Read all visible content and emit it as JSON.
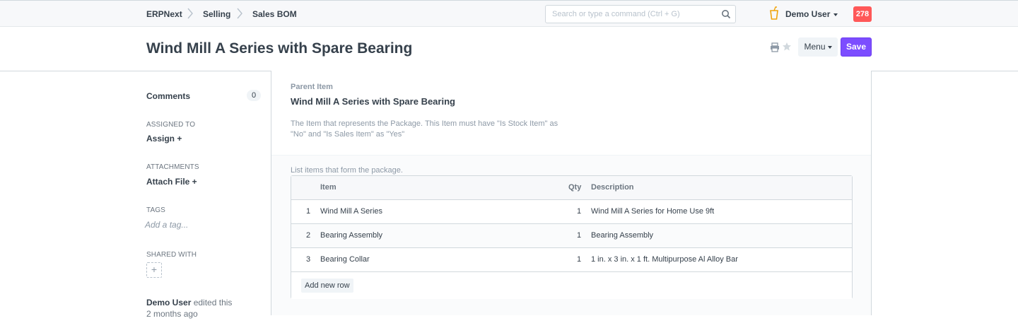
{
  "navbar": {
    "breadcrumbs": [
      "ERPNext",
      "Selling",
      "Sales BOM"
    ],
    "search_placeholder": "Search or type a command (Ctrl + G)",
    "user_name": "Demo User",
    "notification_count": "278"
  },
  "page": {
    "title": "Wind Mill A Series with Spare Bearing",
    "menu_label": "Menu",
    "save_label": "Save"
  },
  "sidebar": {
    "comments_label": "Comments",
    "comments_count": "0",
    "assigned_to_label": "ASSIGNED TO",
    "assign_label": "Assign +",
    "attachments_label": "ATTACHMENTS",
    "attach_label": "Attach File +",
    "tags_label": "TAGS",
    "tag_placeholder": "Add a tag...",
    "shared_with_label": "SHARED WITH",
    "share_add": "+",
    "activity_user": "Demo User",
    "activity_text": "edited this",
    "activity_time": "2 months ago"
  },
  "form": {
    "parent_item_label": "Parent Item",
    "parent_item_value": "Wind Mill A Series with Spare Bearing",
    "parent_item_desc": "The Item that represents the Package. This Item must have \"Is Stock Item\" as \"No\" and \"Is Sales Item\" as \"Yes\"",
    "items_desc": "List items that form the package.",
    "columns": {
      "item": "Item",
      "qty": "Qty",
      "description": "Description"
    },
    "rows": [
      {
        "idx": "1",
        "item": "Wind Mill A Series",
        "qty": "1",
        "description": "Wind Mill A Series for Home Use 9ft"
      },
      {
        "idx": "2",
        "item": "Bearing Assembly",
        "qty": "1",
        "description": "Bearing Assembly"
      },
      {
        "idx": "3",
        "item": "Bearing Collar",
        "qty": "1",
        "description": "1 in. x 3 in. x 1 ft. Multipurpose Al Alloy Bar"
      }
    ],
    "add_row_label": "Add new row"
  }
}
